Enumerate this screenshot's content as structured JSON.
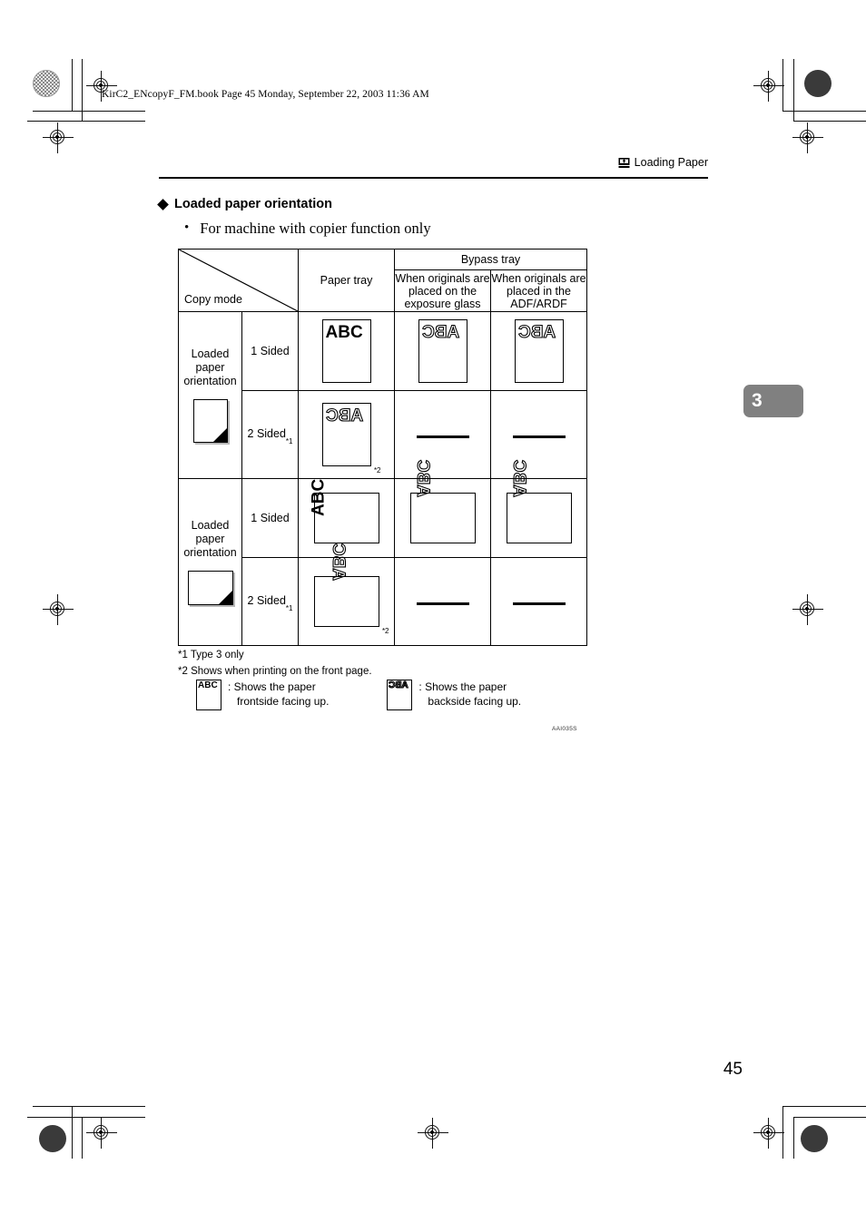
{
  "book": {
    "filebar": "KirC2_ENcopyF_FM.book  Page 45  Monday, September 22, 2003  11:36 AM",
    "running_header": "Loading Paper",
    "running_header_icon": "load-paper-icon",
    "chapter_tab": "3",
    "page_number": "45",
    "figure_code": "AAI035S"
  },
  "section": {
    "heading": "Loaded paper orientation",
    "heading_marker": "diamond-bullet-icon",
    "bullet_marker": "bullet-dot-icon",
    "bullet": "For machine with copier function only"
  },
  "table": {
    "corner": {
      "label": "Copy mode",
      "diagonal": "diagonal-divider"
    },
    "headers": {
      "paper_tray": "Paper tray",
      "bypass_tray": "Bypass tray",
      "bypass_exposure_glass": "When originals are placed on the exposure glass",
      "bypass_adf": "When originals are placed in the ADF/ARDF"
    },
    "groups": [
      {
        "label": "Loaded paper orientation",
        "icon": "portrait-paper-folded-corner-icon",
        "orientation": "portrait",
        "rows": [
          {
            "mode": "1 Sided",
            "mode_note": "",
            "paper_tray": {
              "text": "ABC",
              "style": "solid",
              "note": ""
            },
            "bypass_glass": {
              "text": "ABC",
              "style": "mirror",
              "note": ""
            },
            "bypass_adf": {
              "text": "ABC",
              "style": "mirror",
              "note": ""
            }
          },
          {
            "mode": "2 Sided",
            "mode_note": "*1",
            "paper_tray": {
              "text": "ABC",
              "style": "mirror",
              "note": "*2"
            },
            "bypass_glass": {
              "text": "",
              "style": "dash",
              "note": ""
            },
            "bypass_adf": {
              "text": "",
              "style": "dash",
              "note": ""
            }
          }
        ]
      },
      {
        "label": "Loaded paper orientation",
        "icon": "landscape-paper-folded-corner-icon",
        "orientation": "landscape",
        "rows": [
          {
            "mode": "1 Sided",
            "mode_note": "",
            "paper_tray": {
              "text": "ABC",
              "style": "solid",
              "note": ""
            },
            "bypass_glass": {
              "text": "ABC",
              "style": "mirror",
              "note": ""
            },
            "bypass_adf": {
              "text": "ABC",
              "style": "mirror",
              "note": ""
            }
          },
          {
            "mode": "2 Sided",
            "mode_note": "*1",
            "paper_tray": {
              "text": "ABC",
              "style": "mirror",
              "note": "*2"
            },
            "bypass_glass": {
              "text": "",
              "style": "dash",
              "note": ""
            },
            "bypass_adf": {
              "text": "",
              "style": "dash",
              "note": ""
            }
          }
        ]
      }
    ]
  },
  "footnotes": {
    "note1": "*1 Type 3 only",
    "note2": "*2 Shows when printing on the front page."
  },
  "legend": {
    "front": {
      "sample": "ABC",
      "line1": ": Shows the paper",
      "line2": "frontside facing up."
    },
    "back": {
      "sample": "ABC",
      "line1": ": Shows the paper",
      "line2": "backside facing up."
    }
  }
}
